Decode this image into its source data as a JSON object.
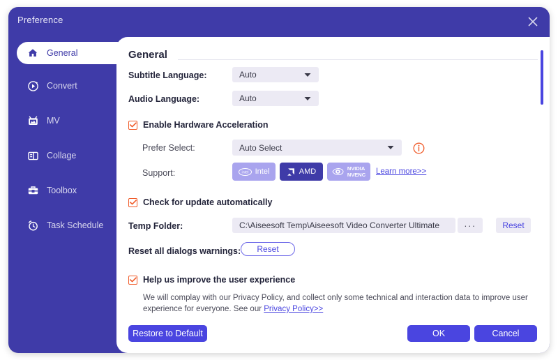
{
  "window": {
    "title": "Preference",
    "close_icon": "close-icon",
    "accent": "#4a45e0",
    "chrome": "#3f3ba8",
    "checkbox_accent": "#f05a28"
  },
  "sidebar": {
    "items": [
      {
        "label": "General",
        "icon": "home-icon",
        "active": true
      },
      {
        "label": "Convert",
        "icon": "play-circle-icon",
        "active": false
      },
      {
        "label": "MV",
        "icon": "video-board-icon",
        "active": false
      },
      {
        "label": "Collage",
        "icon": "layout-panels-icon",
        "active": false
      },
      {
        "label": "Toolbox",
        "icon": "toolbox-icon",
        "active": false
      },
      {
        "label": "Task Schedule",
        "icon": "alarm-clock-icon",
        "active": false
      }
    ]
  },
  "main": {
    "section_title": "General",
    "subtitle_language": {
      "label": "Subtitle Language:",
      "value": "Auto"
    },
    "audio_language": {
      "label": "Audio Language:",
      "value": "Auto"
    },
    "hardware_acceleration": {
      "label": "Enable Hardware Acceleration",
      "checked": true
    },
    "prefer_select": {
      "label": "Prefer Select:",
      "value": "Auto Select",
      "info_icon": "info-circle-icon"
    },
    "support": {
      "label": "Support:",
      "vendors": [
        {
          "name": "Intel",
          "icon": "intel-logo-icon",
          "selected": false
        },
        {
          "name": "AMD",
          "icon": "amd-logo-icon",
          "selected": true
        },
        {
          "name": "NVIDIA NVENC",
          "icon": "nvidia-logo-icon",
          "selected": false,
          "line1": "NVIDIA",
          "line2": "NVENC"
        }
      ],
      "learn_more": "Learn more>>"
    },
    "check_update": {
      "label": "Check for update automatically",
      "checked": true
    },
    "temp_folder": {
      "label": "Temp Folder:",
      "value": "C:\\Aiseesoft Temp\\Aiseesoft Video Converter Ultimate",
      "browse_label": "···",
      "reset_label": "Reset"
    },
    "reset_dialogs": {
      "label": "Reset all dialogs warnings:",
      "button_label": "Reset"
    },
    "improve_experience": {
      "label": "Help us improve the user experience",
      "checked": true,
      "description_before": "We will complay with our Privacy Policy, and collect only some technical and interaction data to improve user experience for everyone. See our ",
      "link_text": "Privacy Policy>>"
    },
    "footer": {
      "restore_label": "Restore to Default",
      "ok_label": "OK",
      "cancel_label": "Cancel"
    }
  }
}
